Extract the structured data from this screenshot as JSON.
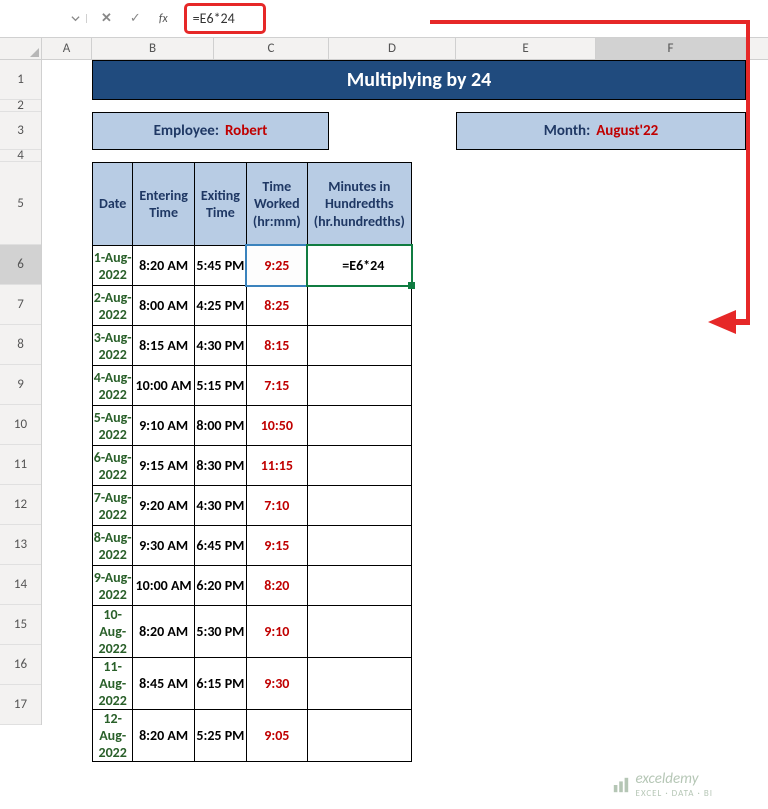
{
  "formula_bar": {
    "name_box": "",
    "formula": "=E6*24",
    "fx_label": "fx"
  },
  "columns": [
    "A",
    "B",
    "C",
    "D",
    "E",
    "F"
  ],
  "rows": [
    "1",
    "2",
    "3",
    "4",
    "5",
    "6",
    "7",
    "8",
    "9",
    "10",
    "11",
    "12",
    "13",
    "14",
    "15",
    "16",
    "17"
  ],
  "banner": {
    "title": "Multiplying by 24"
  },
  "info": {
    "employee_label": "Employee:",
    "employee_value": "Robert",
    "month_label": "Month:",
    "month_value": "August'22"
  },
  "headers": {
    "date": "Date",
    "entering": "Entering Time",
    "exiting": "Exiting Time",
    "worked": "Time Worked (hr:mm)",
    "hundredths": "Minutes in Hundredths (hr.hundredths)"
  },
  "f6_formula": "=E6*24",
  "table": [
    {
      "date": "1-Aug-2022",
      "enter": "8:20 AM",
      "exit": "5:45 PM",
      "worked": "9:25"
    },
    {
      "date": "2-Aug-2022",
      "enter": "8:00 AM",
      "exit": "4:25 PM",
      "worked": "8:25"
    },
    {
      "date": "3-Aug-2022",
      "enter": "8:15 AM",
      "exit": "4:30 PM",
      "worked": "8:15"
    },
    {
      "date": "4-Aug-2022",
      "enter": "10:00 AM",
      "exit": "5:15 PM",
      "worked": "7:15"
    },
    {
      "date": "5-Aug-2022",
      "enter": "9:10 AM",
      "exit": "8:00 PM",
      "worked": "10:50"
    },
    {
      "date": "6-Aug-2022",
      "enter": "9:15 AM",
      "exit": "8:30 PM",
      "worked": "11:15"
    },
    {
      "date": "7-Aug-2022",
      "enter": "9:20 AM",
      "exit": "4:30 PM",
      "worked": "7:10"
    },
    {
      "date": "8-Aug-2022",
      "enter": "9:30 AM",
      "exit": "6:45 PM",
      "worked": "9:15"
    },
    {
      "date": "9-Aug-2022",
      "enter": "10:00 AM",
      "exit": "6:20 PM",
      "worked": "8:20"
    },
    {
      "date": "10-Aug-2022",
      "enter": "8:20 AM",
      "exit": "5:30 PM",
      "worked": "9:10"
    },
    {
      "date": "11-Aug-2022",
      "enter": "8:45 AM",
      "exit": "6:15 PM",
      "worked": "9:30"
    },
    {
      "date": "12-Aug-2022",
      "enter": "8:20 AM",
      "exit": "5:25 PM",
      "worked": "9:05"
    }
  ],
  "watermark": {
    "brand": "exceldemy",
    "tagline": "EXCEL · DATA · BI"
  },
  "chart_data": {
    "type": "table",
    "title": "Multiplying by 24",
    "columns": [
      "Date",
      "Entering Time",
      "Exiting Time",
      "Time Worked (hr:mm)",
      "Minutes in Hundredths (hr.hundredths)"
    ],
    "rows": [
      [
        "1-Aug-2022",
        "8:20 AM",
        "5:45 PM",
        "9:25",
        "=E6*24"
      ],
      [
        "2-Aug-2022",
        "8:00 AM",
        "4:25 PM",
        "8:25",
        ""
      ],
      [
        "3-Aug-2022",
        "8:15 AM",
        "4:30 PM",
        "8:15",
        ""
      ],
      [
        "4-Aug-2022",
        "10:00 AM",
        "5:15 PM",
        "7:15",
        ""
      ],
      [
        "5-Aug-2022",
        "9:10 AM",
        "8:00 PM",
        "10:50",
        ""
      ],
      [
        "6-Aug-2022",
        "9:15 AM",
        "8:30 PM",
        "11:15",
        ""
      ],
      [
        "7-Aug-2022",
        "9:20 AM",
        "4:30 PM",
        "7:10",
        ""
      ],
      [
        "8-Aug-2022",
        "9:30 AM",
        "6:45 PM",
        "9:15",
        ""
      ],
      [
        "9-Aug-2022",
        "10:00 AM",
        "6:20 PM",
        "8:20",
        ""
      ],
      [
        "10-Aug-2022",
        "8:20 AM",
        "5:30 PM",
        "9:10",
        ""
      ],
      [
        "11-Aug-2022",
        "8:45 AM",
        "6:15 PM",
        "9:30",
        ""
      ],
      [
        "12-Aug-2022",
        "8:20 AM",
        "5:25 PM",
        "9:05",
        ""
      ]
    ]
  }
}
